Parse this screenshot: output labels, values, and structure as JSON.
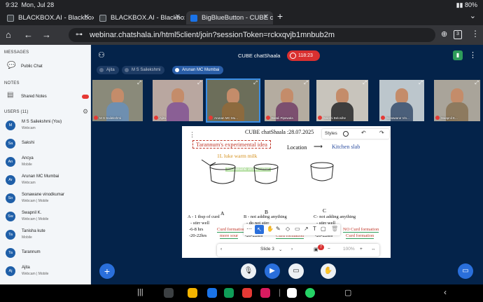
{
  "status": {
    "time": "9:32",
    "date": "Mon, Jul 28",
    "battery": "80%"
  },
  "tabs": [
    {
      "title": "BLACKBOX.AI - Blackbox"
    },
    {
      "title": "BLACKBOX.AI - Blackbox"
    },
    {
      "title": "BigBlueButton - CUBE cl"
    }
  ],
  "address": {
    "url": "webinar.chatshala.in/html5client/join?sessionToken=rckxqvjb1mnbub2m",
    "tab_count": "3"
  },
  "sidebar": {
    "messages_header": "MESSAGES",
    "public_chat": "Public Chat",
    "notes_header": "NOTES",
    "shared_notes": "Shared Notes",
    "users_header": "USERS (11)",
    "users": [
      {
        "initials": "M",
        "name": "M S Sailekshmi (You)",
        "sub": "Webcam"
      },
      {
        "initials": "Sa",
        "name": "Sakshi",
        "sub": ""
      },
      {
        "initials": "An",
        "name": "Ancya",
        "sub": "Mobile"
      },
      {
        "initials": "Ar",
        "name": "Arunan MC Mumbai",
        "sub": "Webcam"
      },
      {
        "initials": "So",
        "name": "Sonawane vinodkumar",
        "sub": "Webcam | Mobile"
      },
      {
        "initials": "Sw",
        "name": "Swapnil K.",
        "sub": "Webcam | Mobile"
      },
      {
        "initials": "Ta",
        "name": "Tanisha kute",
        "sub": "Mobile"
      },
      {
        "initials": "Ta",
        "name": "Tarannum",
        "sub": ""
      },
      {
        "initials": "Aj",
        "name": "Ajita",
        "sub": "Webcam | Mobile"
      }
    ]
  },
  "meeting": {
    "title": "CUBE chatShaala",
    "timer": "118:23"
  },
  "talkers": [
    "Ajita",
    "M S Sailekshmi",
    "Arunan MC Mumbai"
  ],
  "videos": [
    "M S Sailekshmi",
    "Ajita",
    "Arunan MC Mu...",
    "Batali Pipewala",
    "Sakshi Belosihe",
    "Sonawane Vin...",
    "Swapnil K..."
  ],
  "slide": {
    "header": "CUBE chatShaala :28.07.2025",
    "styles_label": "Styles",
    "title": "Tarannum's experimental idea",
    "location_label": "Location",
    "location_value": "Kitchen slab",
    "milk_label": "1L luke warm milk",
    "cursor_label": "Sonawane vinodkumar",
    "cups": [
      "A",
      "B",
      "C"
    ],
    "colA": [
      "A - 1 tbsp of curd",
      "- stirr well",
      "-6-8 hrs",
      "Curd formation",
      "-20-22hrs",
      "more sour"
    ],
    "colB": [
      "B - not adding anything",
      "- do not stirr",
      "-6-8 hrs",
      "NO Curd formation",
      "-20-22hrs",
      "Curd formation"
    ],
    "colC": [
      "C- not adding anything",
      "- stirr well",
      "-6-8 hrs",
      "NO Curd formation",
      "-20-22hrs",
      "Curd formation"
    ],
    "slide_label": "Slide 3",
    "zoom": "100%",
    "badge": "7"
  }
}
